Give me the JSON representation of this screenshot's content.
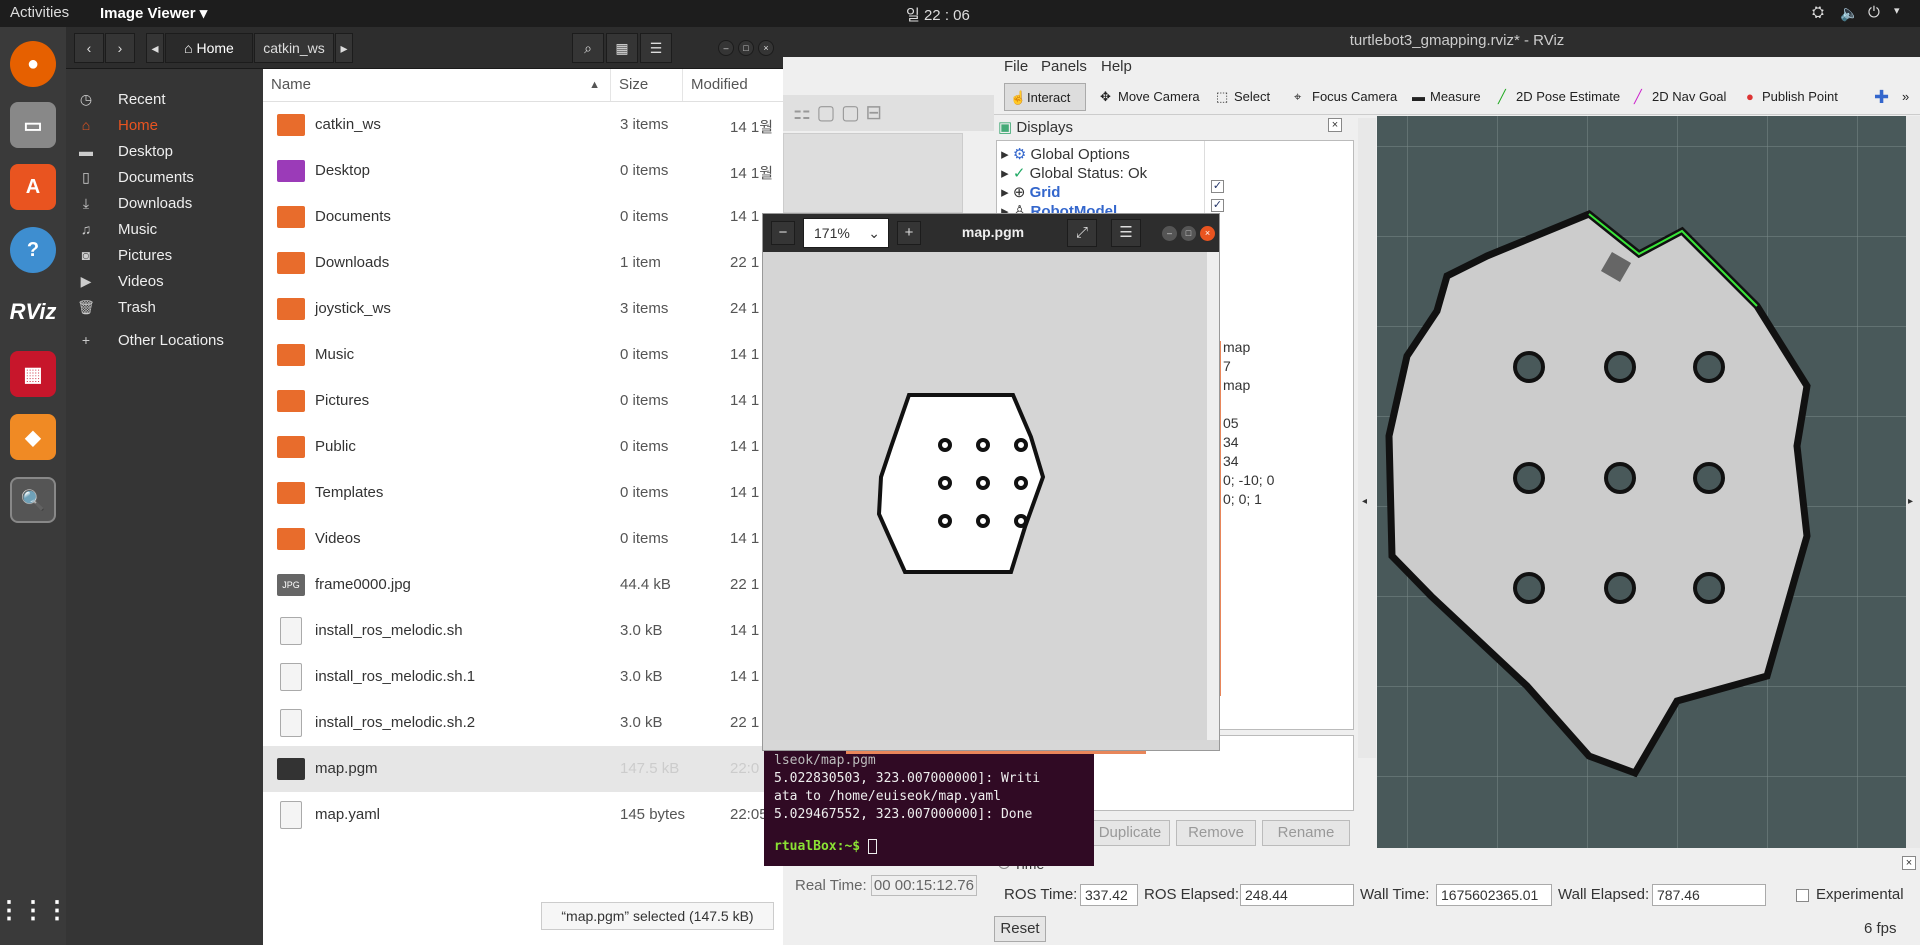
{
  "topbar": {
    "activities": "Activities",
    "app_menu": "Image Viewer ▾",
    "clock": "일 22 : 06"
  },
  "nautilus": {
    "breadcrumb": [
      "Home",
      "catkin_ws"
    ],
    "sidebar": [
      {
        "label": "Recent",
        "icon": "clock-icon"
      },
      {
        "label": "Home",
        "icon": "home-icon"
      },
      {
        "label": "Desktop",
        "icon": "folder-icon"
      },
      {
        "label": "Documents",
        "icon": "document-icon"
      },
      {
        "label": "Downloads",
        "icon": "download-icon"
      },
      {
        "label": "Music",
        "icon": "music-icon"
      },
      {
        "label": "Pictures",
        "icon": "camera-icon"
      },
      {
        "label": "Videos",
        "icon": "video-icon"
      },
      {
        "label": "Trash",
        "icon": "trash-icon"
      },
      {
        "label": "Other Locations",
        "icon": "plus-icon"
      }
    ],
    "columns": {
      "name": "Name",
      "size": "Size",
      "modified": "Modified"
    },
    "files": [
      {
        "name": "catkin_ws",
        "size": "3 items",
        "modified": "14 1월",
        "type": "folder"
      },
      {
        "name": "Desktop",
        "size": "0 items",
        "modified": "14 1월",
        "type": "desktop"
      },
      {
        "name": "Documents",
        "size": "0 items",
        "modified": "14 1",
        "type": "folder"
      },
      {
        "name": "Downloads",
        "size": "1 item",
        "modified": "22 1",
        "type": "folder"
      },
      {
        "name": "joystick_ws",
        "size": "3 items",
        "modified": "24 1",
        "type": "folder"
      },
      {
        "name": "Music",
        "size": "0 items",
        "modified": "14 1",
        "type": "folder"
      },
      {
        "name": "Pictures",
        "size": "0 items",
        "modified": "14 1",
        "type": "folder"
      },
      {
        "name": "Public",
        "size": "0 items",
        "modified": "14 1",
        "type": "folder"
      },
      {
        "name": "Templates",
        "size": "0 items",
        "modified": "14 1",
        "type": "folder"
      },
      {
        "name": "Videos",
        "size": "0 items",
        "modified": "14 1",
        "type": "folder"
      },
      {
        "name": "frame0000.jpg",
        "size": "44.4 kB",
        "modified": "22 1",
        "type": "jpg"
      },
      {
        "name": "install_ros_melodic.sh",
        "size": "3.0 kB",
        "modified": "14 1",
        "type": "text"
      },
      {
        "name": "install_ros_melodic.sh.1",
        "size": "3.0 kB",
        "modified": "14 1",
        "type": "text"
      },
      {
        "name": "install_ros_melodic.sh.2",
        "size": "3.0 kB",
        "modified": "22 1",
        "type": "text"
      },
      {
        "name": "map.pgm",
        "size": "147.5 kB",
        "modified": "22:0",
        "type": "image"
      },
      {
        "name": "map.yaml",
        "size": "145 bytes",
        "modified": "22:05",
        "type": "text"
      }
    ],
    "status": "“map.pgm” selected  (147.5 kB)"
  },
  "imageviewer": {
    "zoom": "171%",
    "title": "map.pgm"
  },
  "terminal": {
    "lines": [
      "lseok/map.pgm",
      "5.022830503, 323.007000000]: Writi",
      "ata to /home/euiseok/map.yaml",
      "5.029467552, 323.007000000]: Done"
    ],
    "prompt": "rtualBox:~$ "
  },
  "rviz": {
    "title": "turtlebot3_gmapping.rviz* - RViz",
    "menu": [
      "File",
      "Panels",
      "Help"
    ],
    "tools": [
      "Interact",
      "Move Camera",
      "Select",
      "Focus Camera",
      "Measure",
      "2D Pose Estimate",
      "2D Nav Goal",
      "Publish Point"
    ],
    "displays": {
      "title": "Displays",
      "items": [
        "Global Options",
        "Global Status: Ok",
        "Grid",
        "RobotModel"
      ],
      "values": [
        "map",
        "7",
        "map",
        "",
        "05",
        "34",
        "34",
        "0; -10; 0",
        "0; 0; 1"
      ]
    },
    "buttons": {
      "duplicate": "Duplicate",
      "remove": "Remove",
      "rename": "Rename"
    },
    "time": {
      "label": "Time",
      "ros_time_label": "ROS Time:",
      "ros_time": "337.42",
      "ros_elapsed_label": "ROS Elapsed:",
      "ros_elapsed": "248.44",
      "wall_time_label": "Wall Time:",
      "wall_time": "1675602365.01",
      "wall_elapsed_label": "Wall Elapsed:",
      "wall_elapsed": "787.46",
      "experimental": "Experimental",
      "reset": "Reset",
      "fps": "6 fps"
    },
    "bg_real_time_label": "Real Time:",
    "bg_real_time": "00 00:15:12.76"
  }
}
